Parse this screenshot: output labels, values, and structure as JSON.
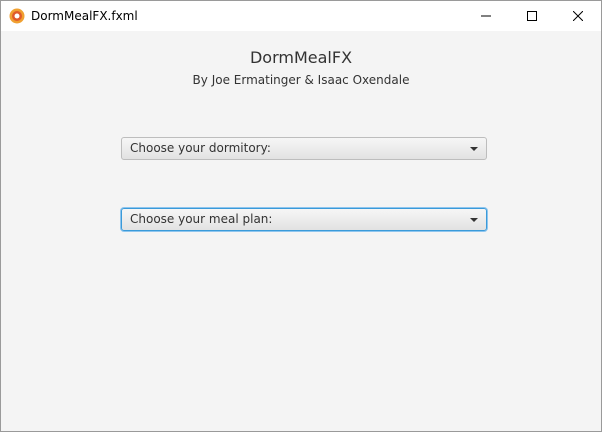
{
  "window": {
    "title": "DormMealFX.fxml",
    "icon": "javafx-app-icon",
    "controls": [
      "minimize-icon",
      "maximize-icon",
      "close-icon"
    ]
  },
  "main": {
    "heading": "DormMealFX",
    "subheading": "By Joe Ermatinger & Isaac Oxendale",
    "dormitory_select": {
      "value": "Choose your dormitory:",
      "icon": "chevron-down-icon"
    },
    "meal_plan_select": {
      "value": "Choose your meal plan:",
      "icon": "chevron-down-icon",
      "focused": true
    }
  },
  "colors": {
    "background": "#f4f4f4",
    "titlebar": "#ffffff",
    "focus_ring": "#3a9ad9",
    "icon_orange": "#f0a030"
  }
}
